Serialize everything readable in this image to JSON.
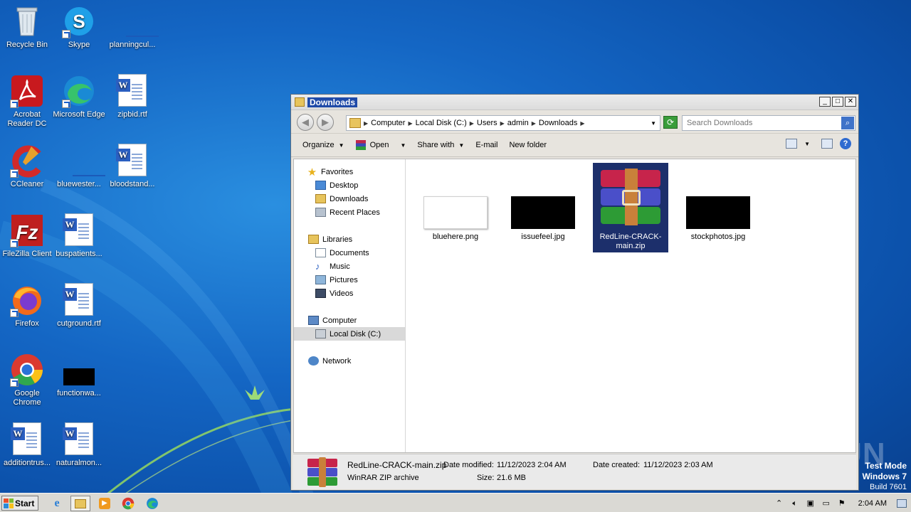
{
  "desktop": {
    "icons": [
      {
        "label": "Recycle Bin"
      },
      {
        "label": "Skype"
      },
      {
        "label": "planningcul..."
      },
      {
        "label": "Acrobat Reader DC"
      },
      {
        "label": "Microsoft Edge"
      },
      {
        "label": "zipbid.rtf"
      },
      {
        "label": "CCleaner"
      },
      {
        "label": "bluewester..."
      },
      {
        "label": "bloodstand..."
      },
      {
        "label": "FileZilla Client"
      },
      {
        "label": "buspatients..."
      },
      {
        "label": "Firefox"
      },
      {
        "label": "cutground.rtf"
      },
      {
        "label": "Google Chrome"
      },
      {
        "label": "functionwa..."
      },
      {
        "label": "additiontrus..."
      },
      {
        "label": "naturalmon..."
      }
    ]
  },
  "window": {
    "title": "Downloads",
    "buttons": {
      "minimize": "_",
      "maximize": "□",
      "close": "✕"
    },
    "address": {
      "crumbs": [
        "Computer",
        "Local Disk (C:)",
        "Users",
        "admin",
        "Downloads"
      ]
    },
    "search": {
      "placeholder": "Search Downloads"
    },
    "toolbar": {
      "organize": "Organize",
      "open": "Open",
      "share_with": "Share with",
      "email": "E-mail",
      "new_folder": "New folder"
    },
    "nav": {
      "favorites": "Favorites",
      "desktop": "Desktop",
      "downloads": "Downloads",
      "recent_places": "Recent Places",
      "libraries": "Libraries",
      "documents": "Documents",
      "music": "Music",
      "pictures": "Pictures",
      "videos": "Videos",
      "computer": "Computer",
      "local_disk": "Local Disk (C:)",
      "network": "Network"
    },
    "files": [
      {
        "name": "bluehere.png"
      },
      {
        "name": "issuefeel.jpg"
      },
      {
        "name": "RedLine-CRACK-main.zip",
        "selected": true
      },
      {
        "name": "stockphotos.jpg"
      }
    ],
    "details": {
      "filename": "RedLine-CRACK-main.zip",
      "type": "WinRAR ZIP archive",
      "modified_label": "Date modified:",
      "modified_value": "11/12/2023 2:04 AM",
      "created_label": "Date created:",
      "created_value": "11/12/2023 2:03 AM",
      "size_label": "Size:",
      "size_value": "21.6 MB"
    }
  },
  "taskbar": {
    "start": "Start",
    "clock": "2:04 AM"
  },
  "overlay": {
    "watermark": "ANY RUN",
    "test_mode": "Test Mode",
    "os": "Windows 7",
    "build": "Build 7601"
  }
}
